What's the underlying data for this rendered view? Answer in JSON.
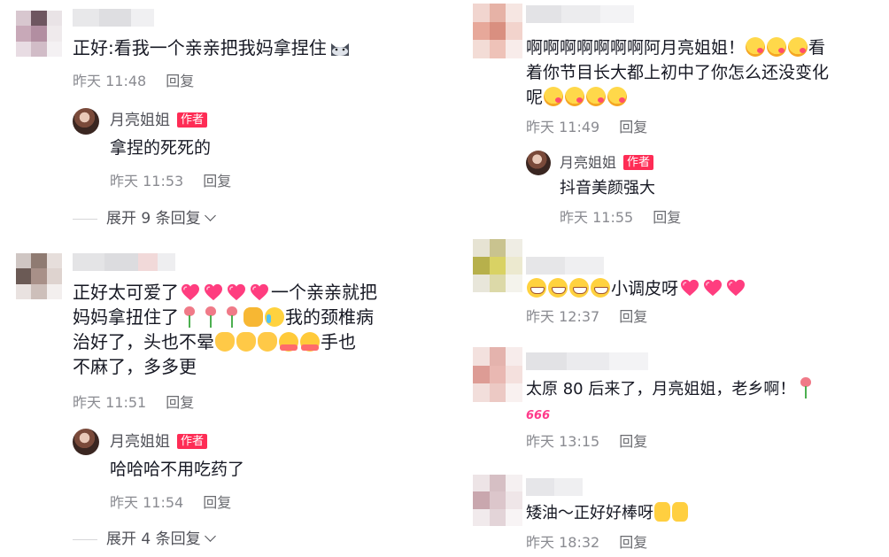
{
  "colors": {
    "author_badge": "#fe2c55",
    "meta_text": "#8a8b91",
    "body_text": "#161823"
  },
  "left": {
    "c1": {
      "text": "正好:看我一个亲亲把我妈拿捏住",
      "time": "昨天 11:48",
      "reply_label": "回复",
      "reply": {
        "name": "月亮姐姐",
        "badge": "作者",
        "text": "拿捏的死死的",
        "time": "昨天 11:53",
        "reply_label": "回复"
      },
      "expand": "展开 9 条回复"
    },
    "c2": {
      "line1": "正好太可爱了",
      "line1_tail": "一个亲亲就把",
      "line2": "妈妈拿扭住了",
      "line2_tail": "我的颈椎病",
      "line3": "治好了，头也不晕",
      "line3_tail": "手也",
      "line4": "不麻了，多多更",
      "time": "昨天 11:51",
      "reply_label": "回复",
      "reply": {
        "name": "月亮姐姐",
        "badge": "作者",
        "text": "哈哈哈不用吃药了",
        "time": "昨天 11:54",
        "reply_label": "回复"
      },
      "expand": "展开 4 条回复"
    }
  },
  "right": {
    "c1": {
      "line1": "啊啊啊啊啊啊啊阿月亮姐姐！",
      "line1_tail": "看",
      "line2": "着你节目长大都上初中了你怎么还没变化",
      "line3": "呢",
      "time": "昨天 11:49",
      "reply_label": "回复",
      "reply": {
        "name": "月亮姐姐",
        "badge": "作者",
        "text": "抖音美颜强大",
        "time": "昨天 11:55",
        "reply_label": "回复"
      }
    },
    "c2": {
      "tail": "小调皮呀",
      "time": "昨天 12:37",
      "reply_label": "回复"
    },
    "c3": {
      "text": "太原 80 后来了，月亮姐姐，老乡啊！",
      "badge666": "666",
      "time": "昨天 13:15",
      "reply_label": "回复"
    },
    "c4": {
      "text": "矮油～正好好棒呀",
      "time": "昨天 18:32",
      "reply_label": "回复"
    }
  }
}
